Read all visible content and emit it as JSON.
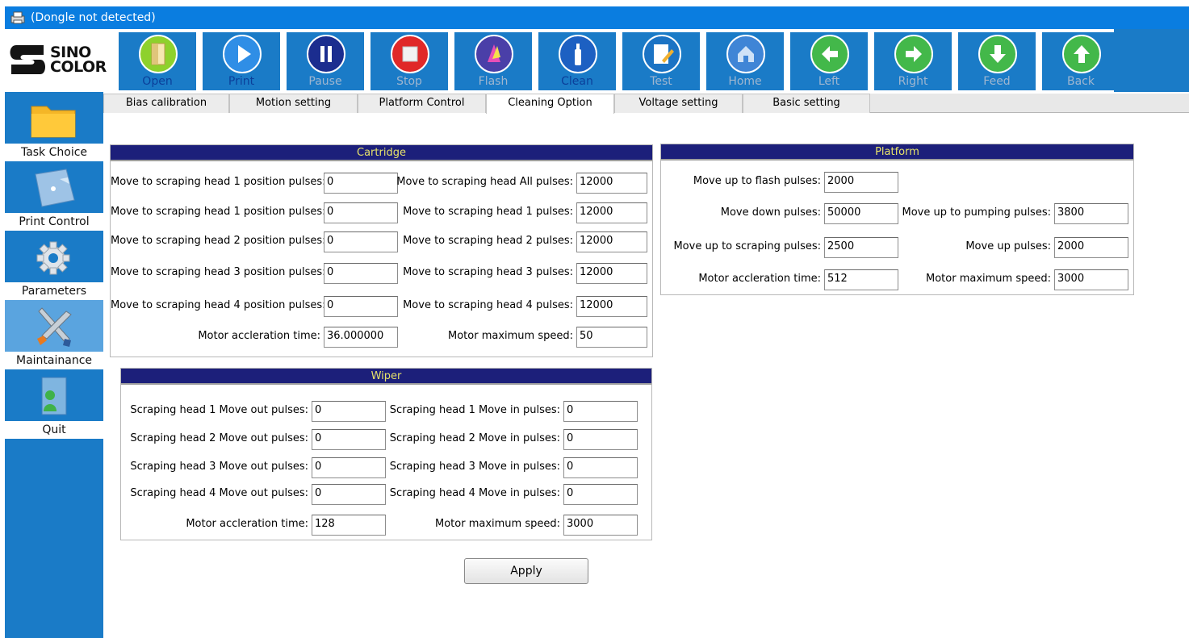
{
  "window": {
    "title": "(Dongle not detected)"
  },
  "logo": {
    "line1": "SINO",
    "line2": "COLOR"
  },
  "toolbar": {
    "buttons": [
      {
        "label": "Open",
        "enabled": true,
        "color": "#8ed12c"
      },
      {
        "label": "Print",
        "enabled": true,
        "color": "#2f8ee6"
      },
      {
        "label": "Pause",
        "enabled": false,
        "color": "#1b2d8f"
      },
      {
        "label": "Stop",
        "enabled": false,
        "color": "#e02828"
      },
      {
        "label": "Flash",
        "enabled": false,
        "color": "#4a3fa8"
      },
      {
        "label": "Clean",
        "enabled": true,
        "color": "#1d60c2"
      },
      {
        "label": "Test",
        "enabled": false,
        "color": "#1b73c4"
      },
      {
        "label": "Home",
        "enabled": false,
        "color": "#3f85d6"
      },
      {
        "label": "Left",
        "enabled": false,
        "color": "#43b84a"
      },
      {
        "label": "Right",
        "enabled": false,
        "color": "#43b84a"
      },
      {
        "label": "Feed",
        "enabled": false,
        "color": "#43b84a"
      },
      {
        "label": "Back",
        "enabled": false,
        "color": "#43b84a"
      }
    ]
  },
  "sidebar": {
    "items": [
      {
        "label": "Task Choice"
      },
      {
        "label": "Print Control"
      },
      {
        "label": "Parameters"
      },
      {
        "label": "Maintainance"
      },
      {
        "label": "Quit"
      }
    ]
  },
  "tabs": [
    {
      "label": "Bias calibration",
      "active": false
    },
    {
      "label": "Motion setting",
      "active": false
    },
    {
      "label": "Platform Control",
      "active": false
    },
    {
      "label": "Cleaning Option",
      "active": true
    },
    {
      "label": "Voltage setting",
      "active": false
    },
    {
      "label": "Basic setting",
      "active": false
    }
  ],
  "cartridge": {
    "title": "Cartridge",
    "left": [
      {
        "label": "Move to scraping head 1 position pulses:",
        "value": "0"
      },
      {
        "label": "Move to scraping head 1 position pulses:",
        "value": "0"
      },
      {
        "label": "Move to scraping head 2 position pulses:",
        "value": "0"
      },
      {
        "label": "Move to scraping head 3 position pulses:",
        "value": "0"
      },
      {
        "label": "Move to scraping head 4 position pulses:",
        "value": "0"
      },
      {
        "label": "Motor accleration time:",
        "value": "36.000000"
      }
    ],
    "right": [
      {
        "label": "Move to scraping head All pulses:",
        "value": "12000"
      },
      {
        "label": "Move to scraping head 1 pulses:",
        "value": "12000"
      },
      {
        "label": "Move to scraping head 2 pulses:",
        "value": "12000"
      },
      {
        "label": "Move to scraping head 3 pulses:",
        "value": "12000"
      },
      {
        "label": "Move to scraping head 4 pulses:",
        "value": "12000"
      },
      {
        "label": "Motor maximum speed:",
        "value": "50"
      }
    ]
  },
  "wiper": {
    "title": "Wiper",
    "left": [
      {
        "label": "Scraping head 1 Move out pulses:",
        "value": "0"
      },
      {
        "label": "Scraping head 2 Move out pulses:",
        "value": "0"
      },
      {
        "label": "Scraping head 3 Move out pulses:",
        "value": "0"
      },
      {
        "label": "Scraping head 4 Move out pulses:",
        "value": "0"
      },
      {
        "label": "Motor accleration time:",
        "value": "128"
      }
    ],
    "right": [
      {
        "label": "Scraping head 1 Move in pulses:",
        "value": "0"
      },
      {
        "label": "Scraping head 2 Move in pulses:",
        "value": "0"
      },
      {
        "label": "Scraping head 3 Move in pulses:",
        "value": "0"
      },
      {
        "label": "Scraping head 4 Move in pulses:",
        "value": "0"
      },
      {
        "label": "Motor maximum speed:",
        "value": "3000"
      }
    ]
  },
  "platform": {
    "title": "Platform",
    "left": [
      {
        "label": "Move up to flash pulses:",
        "value": "2000"
      },
      {
        "label": "Move down pulses:",
        "value": "50000"
      },
      {
        "label": "Move up to scraping pulses:",
        "value": "2500"
      },
      {
        "label": "Motor accleration time:",
        "value": "512"
      }
    ],
    "right": [
      {
        "label": "Move up to pumping pulses:",
        "value": "3800"
      },
      {
        "label": "Move up pulses:",
        "value": "2000"
      },
      {
        "label": "Motor maximum speed:",
        "value": "3000"
      }
    ]
  },
  "apply": {
    "label": "Apply"
  }
}
